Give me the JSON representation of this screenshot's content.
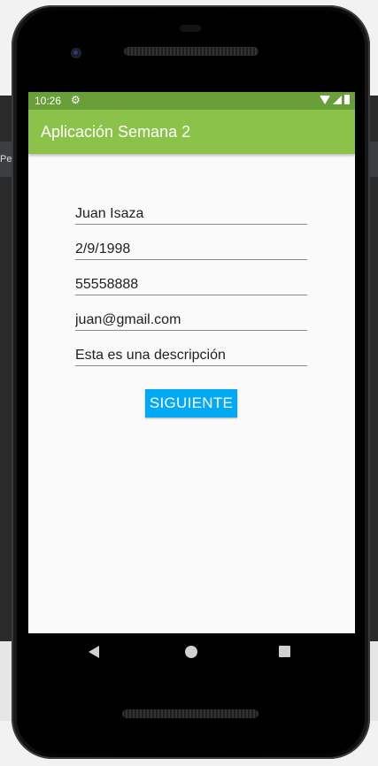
{
  "background_ide": {
    "tab_label": "Pet"
  },
  "status_bar": {
    "time": "10:26",
    "gear_icon": "settings-gear-icon",
    "icons": [
      "wifi-icon",
      "signal-icon",
      "battery-icon"
    ],
    "color": "#689f38"
  },
  "app_bar": {
    "title": "Aplicación Semana 2",
    "color": "#8bc34a"
  },
  "form": {
    "fields": [
      {
        "name": "name",
        "value": "Juan Isaza"
      },
      {
        "name": "birthdate",
        "value": "2/9/1998"
      },
      {
        "name": "phone",
        "value": "55558888"
      },
      {
        "name": "email",
        "value": "juan@gmail.com"
      },
      {
        "name": "description",
        "value": "Esta es una descripción"
      }
    ],
    "submit_label": "SIGUIENTE",
    "submit_color": "#03a9f4"
  },
  "nav_bar": {
    "buttons": [
      "back-icon",
      "home-icon",
      "recents-icon"
    ]
  }
}
